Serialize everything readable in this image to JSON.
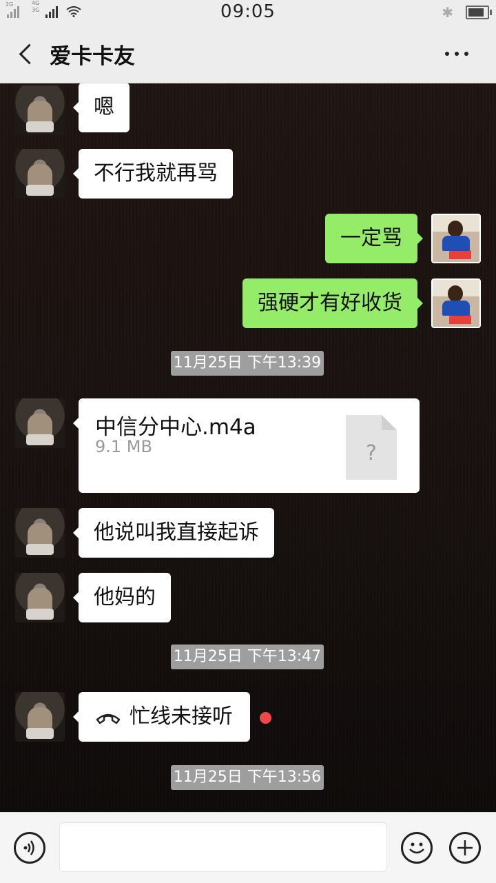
{
  "status_bar": {
    "time": "09:05",
    "signal1_label": "2G",
    "signal2_label_top": "4G",
    "signal2_label_bottom": "3G"
  },
  "nav": {
    "title": "爱卡卡友"
  },
  "messages": [
    {
      "side": "left",
      "type": "text",
      "text": "嗯"
    },
    {
      "side": "left",
      "type": "text",
      "text": "不行我就再骂"
    },
    {
      "side": "right",
      "type": "text",
      "text": "一定骂"
    },
    {
      "side": "right",
      "type": "text",
      "text": "强硬才有好收货"
    },
    {
      "type": "timestamp",
      "text": "11月25日 下午13:39"
    },
    {
      "side": "left",
      "type": "file",
      "file_name": "中信分中心.m4a",
      "file_size": "9.1 MB",
      "file_icon_glyph": "?"
    },
    {
      "side": "left",
      "type": "text",
      "text": "他说叫我直接起诉"
    },
    {
      "side": "left",
      "type": "text",
      "text": "他妈的"
    },
    {
      "type": "timestamp",
      "text": "11月25日 下午13:47"
    },
    {
      "side": "left",
      "type": "call",
      "text": "忙线未接听",
      "icon": "phone-hangup-icon"
    },
    {
      "type": "timestamp",
      "text": "11月25日 下午13:56"
    }
  ],
  "colors": {
    "incoming_bubble": "#ffffff",
    "outgoing_bubble": "#95ec69",
    "timestamp_bg": "#9e9e9e",
    "unread_dot": "#f04848",
    "bar_bg": "#ededed"
  },
  "icons": {
    "back": "chevron-left-icon",
    "more": "more-dots-icon",
    "voice": "voice-icon",
    "emoji": "emoji-icon",
    "plus": "plus-icon"
  }
}
